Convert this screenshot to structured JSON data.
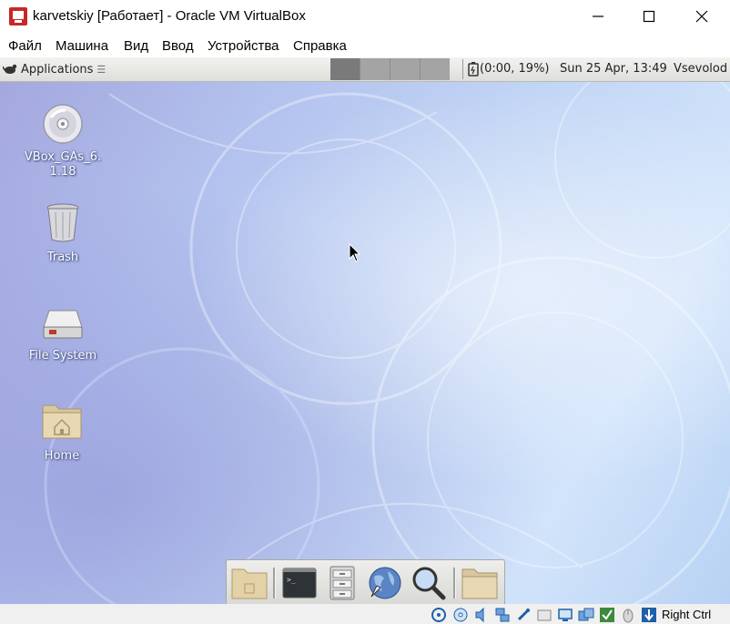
{
  "window": {
    "title": "karvetskiy [Работает] - Oracle VM VirtualBox",
    "minimize_icon": "minimize-icon",
    "maximize_icon": "maximize-icon",
    "close_icon": "close-icon"
  },
  "menu": {
    "items": [
      {
        "label": "Файл"
      },
      {
        "label": "Машина"
      },
      {
        "label": "Вид"
      },
      {
        "label": "Ввод"
      },
      {
        "label": "Устройства"
      },
      {
        "label": "Справка"
      }
    ]
  },
  "panel": {
    "applications_label": "Applications",
    "battery_text": "(0:00, 19%)",
    "clock": "Sun 25 Apr, 13:49",
    "user": "Vsevolod"
  },
  "desktop": {
    "icons": [
      {
        "label_line1": "VBox_GAs_6.",
        "label_line2": "1.18",
        "icon": "cd-disc-icon"
      },
      {
        "label": "Trash",
        "icon": "trash-icon"
      },
      {
        "label": "File System",
        "icon": "drive-icon"
      },
      {
        "label": "Home",
        "icon": "home-folder-icon"
      }
    ]
  },
  "dock": {
    "items": [
      {
        "icon": "show-desktop-icon"
      },
      {
        "icon": "terminal-icon"
      },
      {
        "icon": "file-manager-icon"
      },
      {
        "icon": "web-browser-icon"
      },
      {
        "icon": "app-finder-icon"
      },
      {
        "icon": "folder-icon"
      }
    ]
  },
  "statusbar": {
    "host_key": "Right Ctrl"
  },
  "colors": {
    "titlebar": "#ffffff",
    "panel": "#e6e6e2",
    "desktop_blue": "#c2d6f5",
    "desktop_purple": "#a3a6dd"
  }
}
